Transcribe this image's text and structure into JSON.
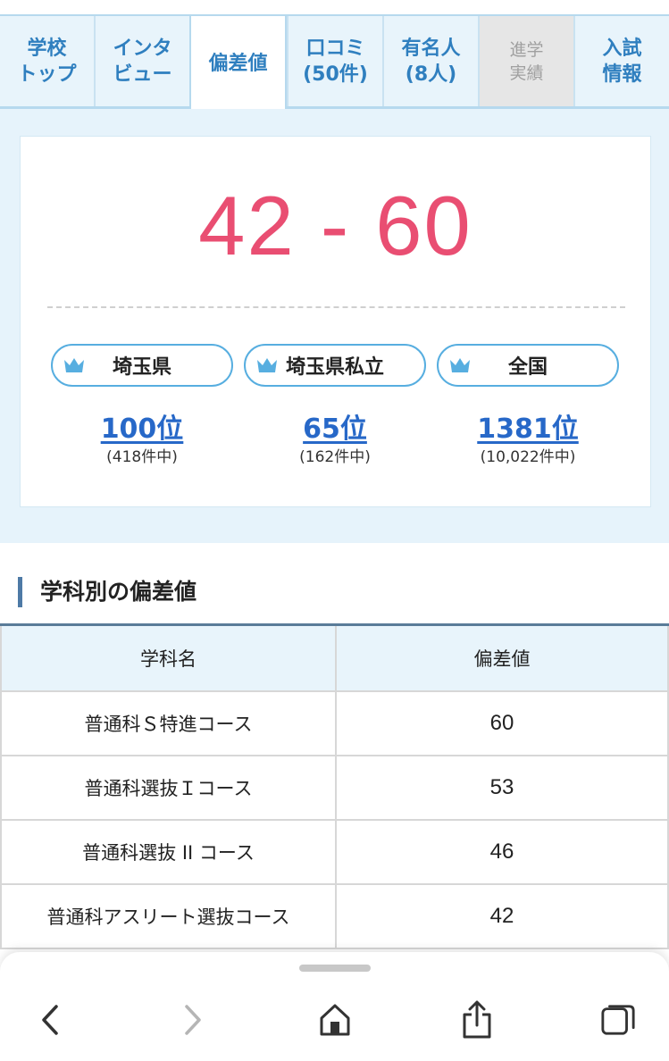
{
  "tabs": [
    {
      "line1": "学校",
      "line2": "トップ",
      "state": "normal"
    },
    {
      "line1": "インタ",
      "line2": "ビュー",
      "state": "normal"
    },
    {
      "line1": "偏差値",
      "line2": "",
      "state": "active"
    },
    {
      "line1": "口コミ",
      "line2": "(50件)",
      "state": "normal"
    },
    {
      "line1": "有名人",
      "line2": "(8人)",
      "state": "normal"
    },
    {
      "line1": "進学",
      "line2": "実績",
      "state": "disabled"
    },
    {
      "line1": "入試",
      "line2": "情報",
      "state": "normal"
    }
  ],
  "score": {
    "range": "42 - 60",
    "rankings": [
      {
        "label": "埼玉県",
        "rank": "100位",
        "total": "(418件中)"
      },
      {
        "label": "埼玉県私立",
        "rank": "65位",
        "total": "(162件中)"
      },
      {
        "label": "全国",
        "rank": "1381位",
        "total": "(10,022件中)"
      }
    ]
  },
  "section": {
    "title": "学科別の偏差値"
  },
  "table": {
    "headers": [
      "学科名",
      "偏差値"
    ],
    "rows": [
      {
        "name": "普通科Ｓ特進コース",
        "value": "60"
      },
      {
        "name": "普通科選抜Ｉコース",
        "value": "53"
      },
      {
        "name": "普通科選抜 II コース",
        "value": "46"
      },
      {
        "name": "普通科アスリート選抜コース",
        "value": "42"
      }
    ]
  },
  "browser": {
    "icons": [
      "back-icon",
      "forward-icon",
      "home-icon",
      "share-icon",
      "tabs-icon"
    ]
  },
  "colors": {
    "accent_pink": "#e94e72",
    "link_blue": "#2768c8",
    "tab_blue": "#2f7fbf",
    "panel_bg": "#e6f3fb"
  }
}
